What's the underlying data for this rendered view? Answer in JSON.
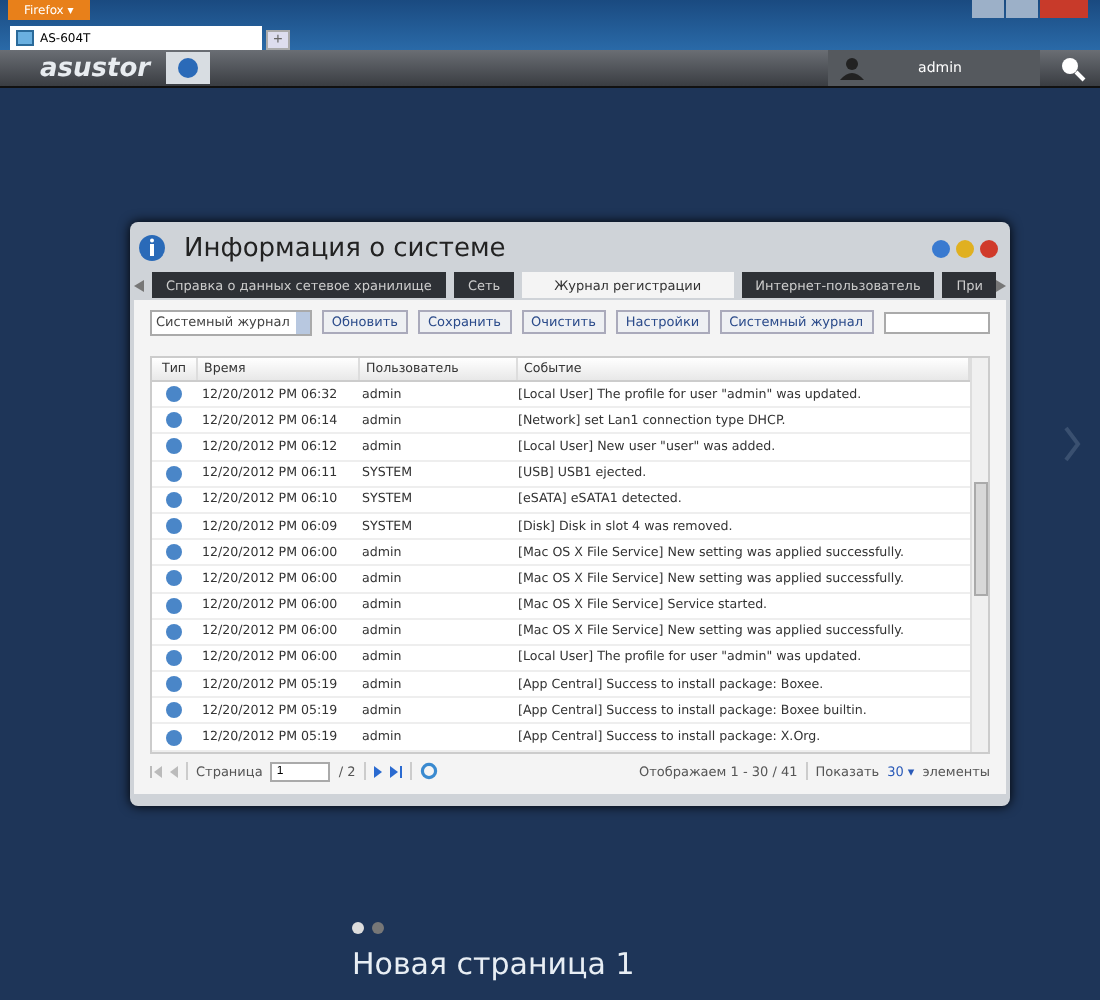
{
  "browser": {
    "menu_button": "Firefox ▾",
    "tabs": [
      {
        "label": "AS-604T",
        "selected": true
      }
    ],
    "new_tab": "+"
  },
  "header": {
    "logo": "asustor",
    "user": "admin"
  },
  "window": {
    "title": "Информация о системе",
    "tabs": [
      {
        "label": "Справка о данных сетевое хранилище",
        "selected": false
      },
      {
        "label": "Сеть",
        "selected": false
      },
      {
        "label": "Журнал регистрации",
        "selected": true
      },
      {
        "label": "Интернет-пользователь",
        "selected": false
      },
      {
        "label": "При",
        "selected": false
      }
    ],
    "toolbar": {
      "dropdown": "Системный журнал",
      "buttons": [
        "Обновить",
        "Сохранить",
        "Очистить",
        "Настройки",
        "Системный журнал"
      ]
    },
    "table": {
      "columns": [
        "Тип",
        "Время",
        "Пользователь",
        "Событие"
      ],
      "rows": [
        {
          "time": "12/20/2012 PM 06:32",
          "user": "admin",
          "event": "[Local User] The profile for user \"admin\" was updated."
        },
        {
          "time": "12/20/2012 PM 06:14",
          "user": "admin",
          "event": "[Network] set Lan1 connection type DHCP."
        },
        {
          "time": "12/20/2012 PM 06:12",
          "user": "admin",
          "event": "[Local User] New user \"user\" was added."
        },
        {
          "time": "12/20/2012 PM 06:11",
          "user": "SYSTEM",
          "event": "[USB] USB1 ejected."
        },
        {
          "time": "12/20/2012 PM 06:10",
          "user": "SYSTEM",
          "event": "[eSATA] eSATA1 detected."
        },
        {
          "time": "12/20/2012 PM 06:09",
          "user": "SYSTEM",
          "event": "[Disk] Disk in slot 4 was removed."
        },
        {
          "time": "12/20/2012 PM 06:00",
          "user": "admin",
          "event": "[Mac OS X File Service] New setting was applied successfully."
        },
        {
          "time": "12/20/2012 PM 06:00",
          "user": "admin",
          "event": "[Mac OS X File Service] New setting was applied successfully."
        },
        {
          "time": "12/20/2012 PM 06:00",
          "user": "admin",
          "event": "[Mac OS X File Service] Service started."
        },
        {
          "time": "12/20/2012 PM 06:00",
          "user": "admin",
          "event": "[Mac OS X File Service] New setting was applied successfully."
        },
        {
          "time": "12/20/2012 PM 06:00",
          "user": "admin",
          "event": "[Local User] The profile for user \"admin\" was updated."
        },
        {
          "time": "12/20/2012 PM 05:19",
          "user": "admin",
          "event": "[App Central] Success to install package: Boxee."
        },
        {
          "time": "12/20/2012 PM 05:19",
          "user": "admin",
          "event": "[App Central] Success to install package: Boxee builtin."
        },
        {
          "time": "12/20/2012 PM 05:19",
          "user": "admin",
          "event": "[App Central] Success to install package: X.Org."
        }
      ]
    },
    "pager": {
      "page_label": "Страница",
      "page": "1",
      "total": "/ 2",
      "range": "Отображаем 1 - 30 / 41",
      "show": "Показать",
      "per_page": "30 ▾",
      "items": "элементы"
    }
  },
  "page_dots": [
    {
      "selected": true
    },
    {
      "selected": false
    }
  ],
  "page_title": "Новая страница 1"
}
